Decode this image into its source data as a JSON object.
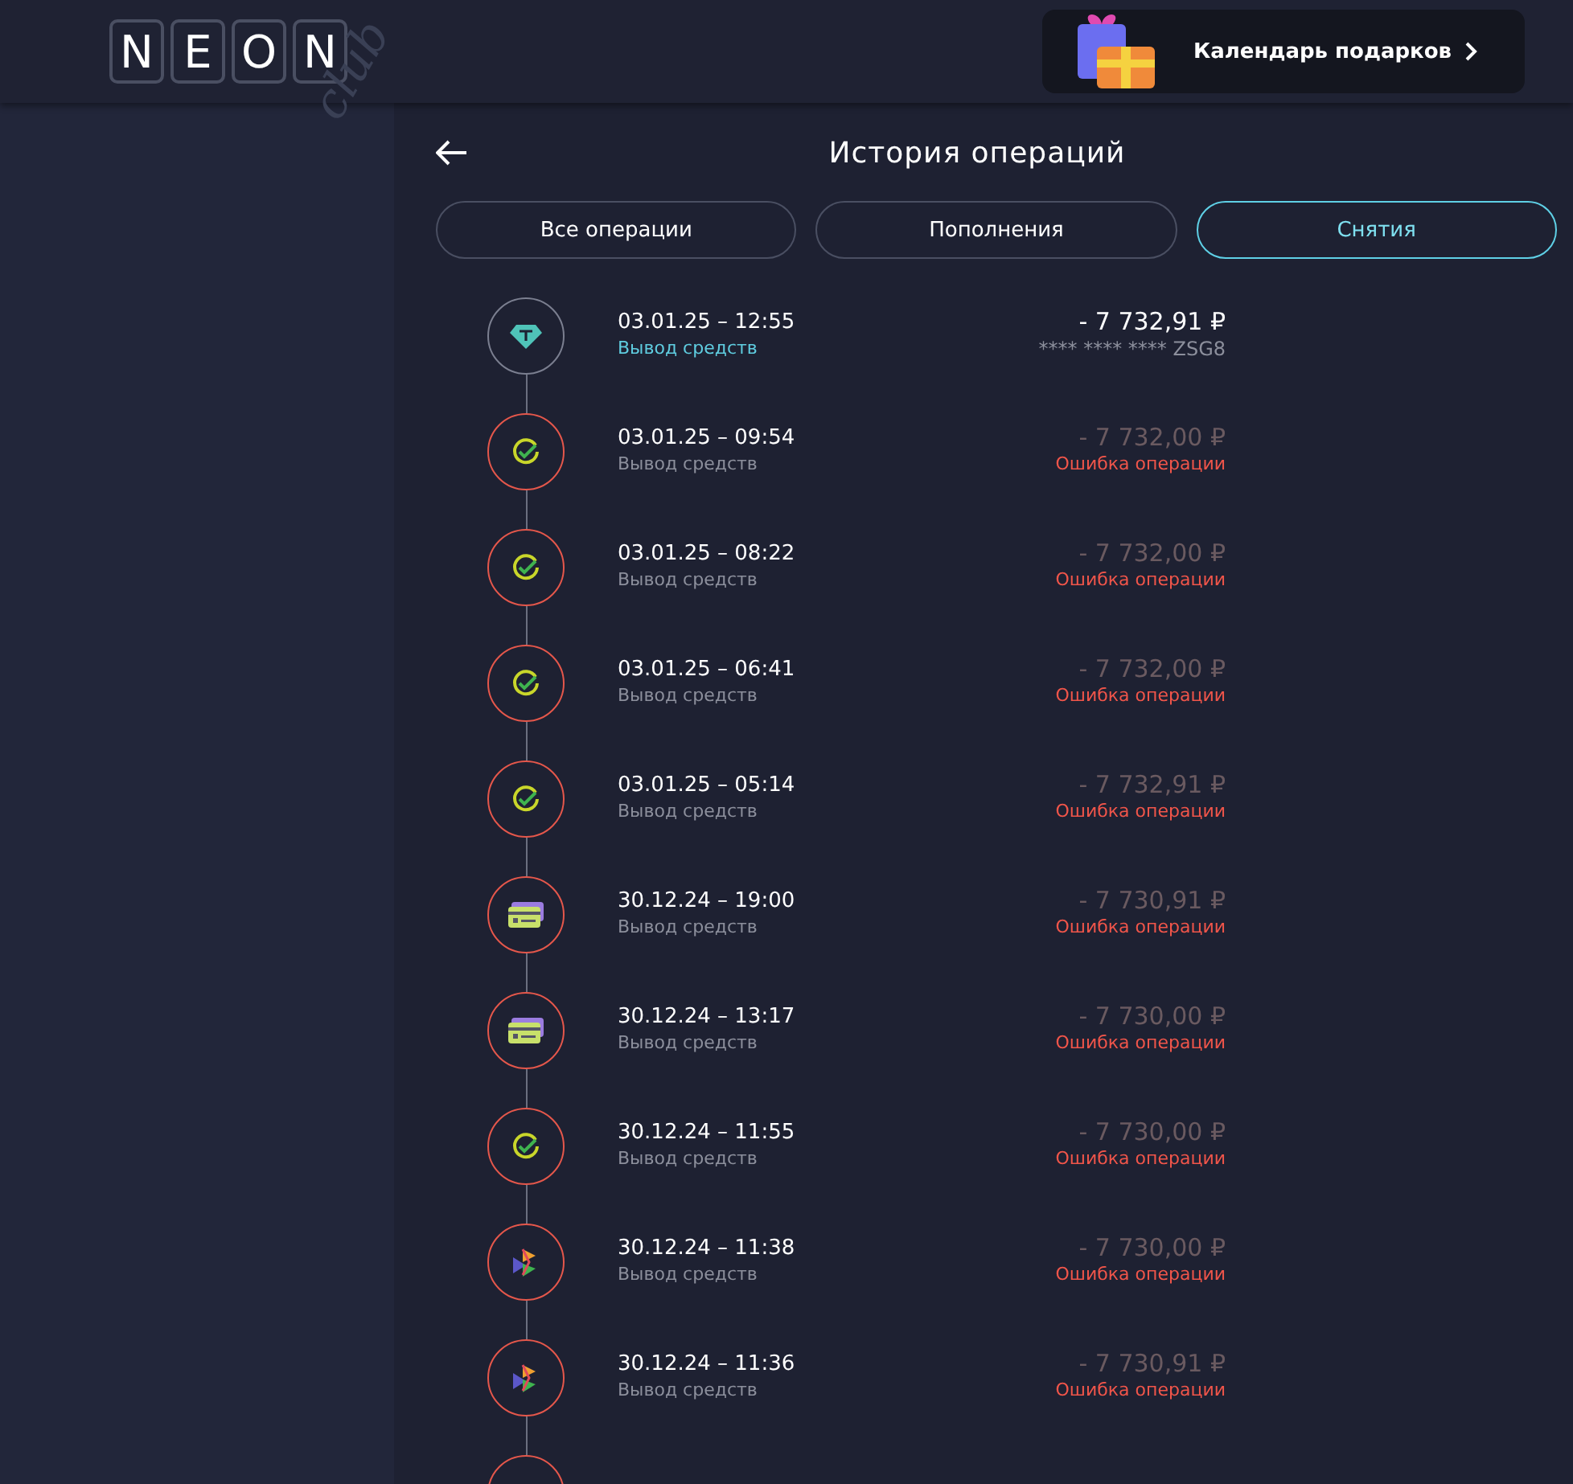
{
  "header": {
    "logo_letters": [
      "N",
      "E",
      "O",
      "N"
    ],
    "logo_script": "club",
    "promo": {
      "label": "Календарь подарков"
    }
  },
  "title": "История операций",
  "tabs": [
    {
      "label": "Все операции",
      "selected": false
    },
    {
      "label": "Пополнения",
      "selected": false
    },
    {
      "label": "Снятия",
      "selected": true
    }
  ],
  "operations": [
    {
      "kind": "tether",
      "failed": false,
      "datetime": "03.01.25 – 12:55",
      "type": "Вывод средств",
      "amount": "- 7 732,91 ₽",
      "note": "**** **** **** ZSG8"
    },
    {
      "kind": "sber",
      "failed": true,
      "datetime": "03.01.25 – 09:54",
      "type": "Вывод средств",
      "amount": "- 7 732,00 ₽",
      "note": "Ошибка операции"
    },
    {
      "kind": "sber",
      "failed": true,
      "datetime": "03.01.25 – 08:22",
      "type": "Вывод средств",
      "amount": "- 7 732,00 ₽",
      "note": "Ошибка операции"
    },
    {
      "kind": "sber",
      "failed": true,
      "datetime": "03.01.25 – 06:41",
      "type": "Вывод средств",
      "amount": "- 7 732,00 ₽",
      "note": "Ошибка операции"
    },
    {
      "kind": "sber",
      "failed": true,
      "datetime": "03.01.25 – 05:14",
      "type": "Вывод средств",
      "amount": "- 7 732,91 ₽",
      "note": "Ошибка операции"
    },
    {
      "kind": "card",
      "failed": true,
      "datetime": "30.12.24 – 19:00",
      "type": "Вывод средств",
      "amount": "- 7 730,91 ₽",
      "note": "Ошибка операции"
    },
    {
      "kind": "card",
      "failed": true,
      "datetime": "30.12.24 – 13:17",
      "type": "Вывод средств",
      "amount": "- 7 730,00 ₽",
      "note": "Ошибка операции"
    },
    {
      "kind": "sber",
      "failed": true,
      "datetime": "30.12.24 – 11:55",
      "type": "Вывод средств",
      "amount": "- 7 730,00 ₽",
      "note": "Ошибка операции"
    },
    {
      "kind": "sbp",
      "failed": true,
      "datetime": "30.12.24 – 11:38",
      "type": "Вывод средств",
      "amount": "- 7 730,00 ₽",
      "note": "Ошибка операции"
    },
    {
      "kind": "sbp",
      "failed": true,
      "datetime": "30.12.24 – 11:36",
      "type": "Вывод средств",
      "amount": "- 7 730,91 ₽",
      "note": "Ошибка операции"
    },
    {
      "kind": "blank",
      "failed": true
    }
  ]
}
